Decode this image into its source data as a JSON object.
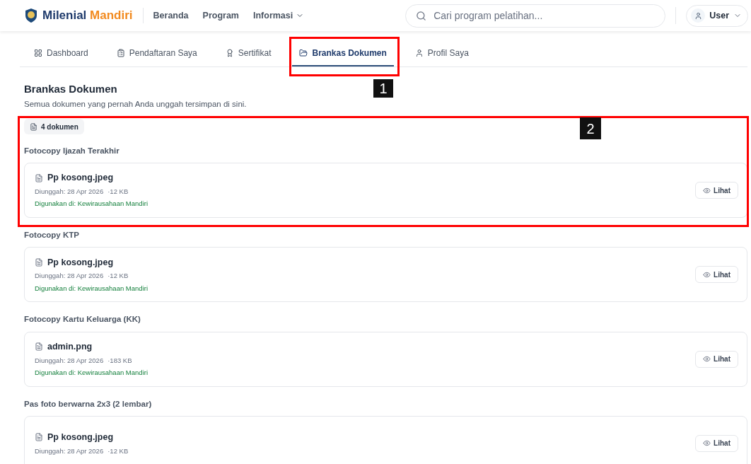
{
  "header": {
    "brand": [
      "Milenial",
      "Mandiri"
    ],
    "nav": [
      {
        "label": "Beranda",
        "dropdown": false
      },
      {
        "label": "Program",
        "dropdown": false
      },
      {
        "label": "Informasi",
        "dropdown": true
      }
    ],
    "search": {
      "placeholder": "Cari program pelatihan..."
    },
    "user": {
      "label": "User"
    }
  },
  "tabs": [
    {
      "label": "Dashboard",
      "selected": false
    },
    {
      "label": "Pendaftaran Saya",
      "selected": false
    },
    {
      "label": "Sertifikat",
      "selected": false
    },
    {
      "label": "Brankas Dokumen",
      "selected": true
    },
    {
      "label": "Profil Saya",
      "selected": false
    }
  ],
  "page": {
    "title": "Brankas Dokumen",
    "subtitle": "Semua dokumen yang pernah Anda unggah tersimpan di sini.",
    "count": "4 dokumen"
  },
  "groups": [
    {
      "heading": "Fotocopy Ijazah Terakhir",
      "file": {
        "name": "Pp kosong.jpeg",
        "date": "Diunggah: 28 Apr 2026",
        "size": "·12 KB",
        "usage": "Digunakan di: Kewirausahaan Mandiri",
        "action": "Lihat"
      }
    },
    {
      "heading": "Fotocopy KTP",
      "file": {
        "name": "Pp kosong.jpeg",
        "date": "Diunggah: 28 Apr 2026",
        "size": "·12 KB",
        "usage": "Digunakan di: Kewirausahaan Mandiri",
        "action": "Lihat"
      }
    },
    {
      "heading": "Fotocopy Kartu Keluarga (KK)",
      "file": {
        "name": "admin.png",
        "date": "Diunggah: 28 Apr 2026",
        "size": "·183 KB",
        "usage": "Digunakan di: Kewirausahaan Mandiri",
        "action": "Lihat"
      }
    },
    {
      "heading": "Pas foto berwarna 2x3 (2 lembar)",
      "file": {
        "name": "Pp kosong.jpeg",
        "date": "Diunggah: 28 Apr 2026",
        "size": "·12 KB",
        "action": "Lihat"
      }
    }
  ],
  "annotations": [
    {
      "label": "1"
    },
    {
      "label": "2"
    }
  ]
}
